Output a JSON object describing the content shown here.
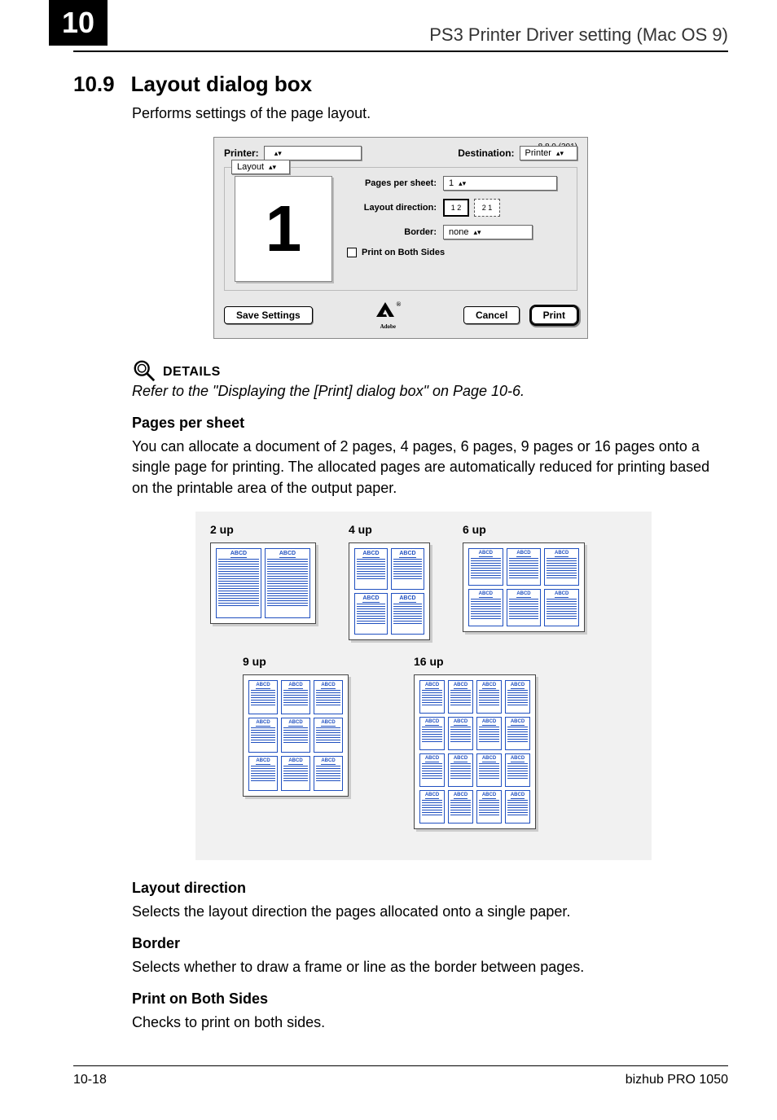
{
  "header": {
    "chapter": "10",
    "title": "PS3 Printer Driver setting (Mac OS 9)"
  },
  "section": {
    "number": "10.9",
    "title": "Layout dialog box",
    "intro": "Performs settings of the page layout."
  },
  "dialog": {
    "version": "8.8.0 (301)",
    "printer_label": "Printer:",
    "printer_value": "",
    "destination_label": "Destination:",
    "destination_value": "Printer",
    "tab": "Layout",
    "preview_number": "1",
    "pages_per_sheet_label": "Pages per sheet:",
    "pages_per_sheet_value": "1",
    "layout_direction_label": "Layout direction:",
    "direction_a": "1 2",
    "direction_b": "2 1",
    "border_label": "Border:",
    "border_value": "none",
    "both_sides_label": "Print on Both Sides",
    "save_settings": "Save Settings",
    "adobe_sub": "Adobe",
    "cancel": "Cancel",
    "print": "Print"
  },
  "details": {
    "label": "DETAILS",
    "ref": "Refer to the \"Displaying the [Print] dialog box\" on Page 10-6."
  },
  "pps": {
    "heading": "Pages per sheet",
    "text": "You can allocate a document of 2 pages, 4 pages, 6 pages, 9 pages or 16 pages onto a single page for printing. The allocated pages are automatically reduced for printing based on the printable area of the output paper."
  },
  "nup": {
    "t2": "2 up",
    "t4": "4 up",
    "t6": "6 up",
    "t9": "9 up",
    "t16": "16 up",
    "cell": "ABCD"
  },
  "layout_direction": {
    "heading": "Layout direction",
    "text": "Selects the layout direction the pages allocated onto a single paper."
  },
  "border": {
    "heading": "Border",
    "text": "Selects whether to draw a frame or line as the border between pages."
  },
  "both_sides": {
    "heading": "Print on Both Sides",
    "text": "Checks to print on both sides."
  },
  "footer": {
    "page": "10-18",
    "product": "bizhub PRO 1050"
  }
}
